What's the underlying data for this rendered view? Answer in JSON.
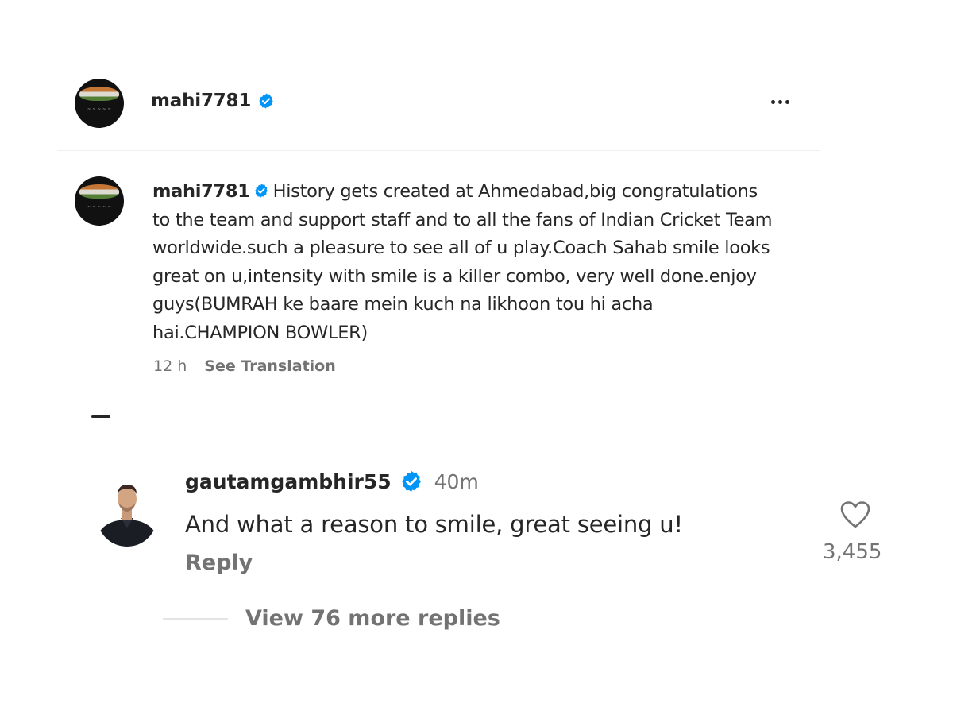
{
  "post": {
    "username": "mahi7781",
    "verified_icon": "verified-badge-icon",
    "more_icon": "more-options-icon",
    "accent_color": "#0095f6"
  },
  "caption": {
    "username": "mahi7781",
    "text": "History gets created at Ahmedabad,big congratulations to the team and support staff and to all the fans of Indian Cricket Team worldwide.such a pleasure to see all of u play.Coach Sahab smile looks great on u,intensity with smile is a killer combo, very well done.enjoy guys(BUMRAH ke baare mein kuch na likhoon tou hi acha hai.CHAMPION BOWLER)",
    "time": "12 h",
    "see_translation": "See Translation"
  },
  "comment": {
    "username": "gautamgambhir55",
    "time": "40m",
    "text": "And what a reason to smile, great seeing u!",
    "reply_label": "Reply",
    "like_count": "3,455",
    "like_icon": "heart-outline-icon",
    "view_replies": "View 76 more replies"
  }
}
